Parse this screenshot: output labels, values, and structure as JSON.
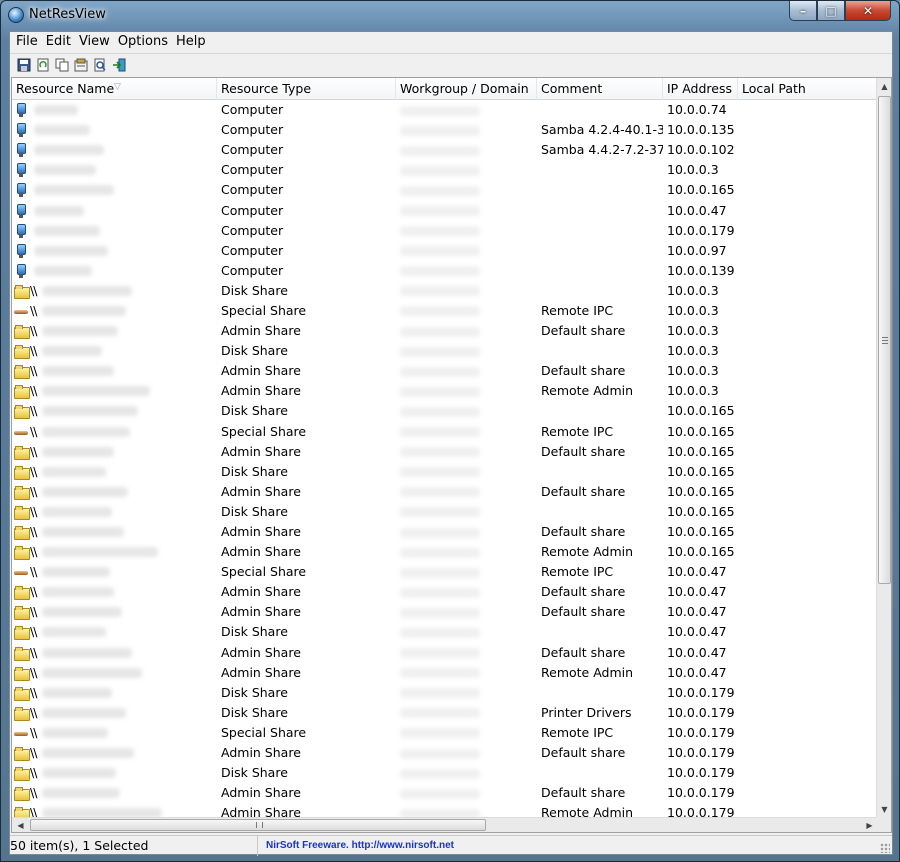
{
  "window": {
    "title": "NetResView"
  },
  "menu": [
    "File",
    "Edit",
    "View",
    "Options",
    "Help"
  ],
  "toolbar": [
    "save-icon",
    "refresh-icon",
    "copy-icon",
    "properties-icon",
    "find-icon",
    "exit-icon"
  ],
  "columns": [
    "Resource Name",
    "Resource Type",
    "Workgroup / Domain",
    "Comment",
    "IP Address",
    "Local Path"
  ],
  "rows": [
    {
      "icon": "computer",
      "prefix": "",
      "type": "Computer",
      "comment": "",
      "ip": "10.0.0.74"
    },
    {
      "icon": "computer",
      "prefix": "",
      "type": "Computer",
      "comment": "Samba 4.2.4-40.1-3...",
      "ip": "10.0.0.135"
    },
    {
      "icon": "computer",
      "prefix": "",
      "type": "Computer",
      "comment": "Samba 4.4.2-7.2-37...",
      "ip": "10.0.0.102"
    },
    {
      "icon": "computer",
      "prefix": "",
      "type": "Computer",
      "comment": "",
      "ip": "10.0.0.3"
    },
    {
      "icon": "computer",
      "prefix": "",
      "type": "Computer",
      "comment": "",
      "ip": "10.0.0.165"
    },
    {
      "icon": "computer",
      "prefix": "",
      "type": "Computer",
      "comment": "",
      "ip": "10.0.0.47"
    },
    {
      "icon": "computer",
      "prefix": "",
      "type": "Computer",
      "comment": "",
      "ip": "10.0.0.179"
    },
    {
      "icon": "computer",
      "prefix": "",
      "type": "Computer",
      "comment": "",
      "ip": "10.0.0.97"
    },
    {
      "icon": "computer",
      "prefix": "",
      "type": "Computer",
      "comment": "",
      "ip": "10.0.0.139"
    },
    {
      "icon": "folder",
      "prefix": "\\\\",
      "type": "Disk Share",
      "comment": "",
      "ip": "10.0.0.3"
    },
    {
      "icon": "pipe",
      "prefix": "\\\\",
      "type": "Special Share",
      "comment": "Remote IPC",
      "ip": "10.0.0.3"
    },
    {
      "icon": "folder",
      "prefix": "\\\\",
      "type": "Admin Share",
      "comment": "Default share",
      "ip": "10.0.0.3"
    },
    {
      "icon": "folder",
      "prefix": "\\\\",
      "type": "Disk Share",
      "comment": "",
      "ip": "10.0.0.3"
    },
    {
      "icon": "folder",
      "prefix": "\\\\",
      "type": "Admin Share",
      "comment": "Default share",
      "ip": "10.0.0.3"
    },
    {
      "icon": "folder",
      "prefix": "\\\\",
      "type": "Admin Share",
      "comment": "Remote Admin",
      "ip": "10.0.0.3"
    },
    {
      "icon": "folder",
      "prefix": "\\\\",
      "type": "Disk Share",
      "comment": "",
      "ip": "10.0.0.165"
    },
    {
      "icon": "pipe",
      "prefix": "\\\\",
      "type": "Special Share",
      "comment": "Remote IPC",
      "ip": "10.0.0.165"
    },
    {
      "icon": "folder",
      "prefix": "\\\\",
      "type": "Admin Share",
      "comment": "Default share",
      "ip": "10.0.0.165"
    },
    {
      "icon": "folder",
      "prefix": "\\\\",
      "type": "Disk Share",
      "comment": "",
      "ip": "10.0.0.165"
    },
    {
      "icon": "folder",
      "prefix": "\\\\",
      "type": "Admin Share",
      "comment": "Default share",
      "ip": "10.0.0.165"
    },
    {
      "icon": "folder",
      "prefix": "\\\\",
      "type": "Disk Share",
      "comment": "",
      "ip": "10.0.0.165"
    },
    {
      "icon": "folder",
      "prefix": "\\\\",
      "type": "Admin Share",
      "comment": "Default share",
      "ip": "10.0.0.165"
    },
    {
      "icon": "folder",
      "prefix": "\\\\",
      "type": "Admin Share",
      "comment": "Remote Admin",
      "ip": "10.0.0.165"
    },
    {
      "icon": "pipe",
      "prefix": "\\\\",
      "type": "Special Share",
      "comment": "Remote IPC",
      "ip": "10.0.0.47"
    },
    {
      "icon": "folder",
      "prefix": "\\\\",
      "type": "Admin Share",
      "comment": "Default share",
      "ip": "10.0.0.47"
    },
    {
      "icon": "folder",
      "prefix": "\\\\",
      "type": "Admin Share",
      "comment": "Default share",
      "ip": "10.0.0.47"
    },
    {
      "icon": "folder",
      "prefix": "\\\\",
      "type": "Disk Share",
      "comment": "",
      "ip": "10.0.0.47"
    },
    {
      "icon": "folder",
      "prefix": "\\\\",
      "type": "Admin Share",
      "comment": "Default share",
      "ip": "10.0.0.47"
    },
    {
      "icon": "folder",
      "prefix": "\\\\",
      "type": "Admin Share",
      "comment": "Remote Admin",
      "ip": "10.0.0.47"
    },
    {
      "icon": "folder",
      "prefix": "\\\\",
      "type": "Disk Share",
      "comment": "",
      "ip": "10.0.0.179"
    },
    {
      "icon": "folder",
      "prefix": "\\\\",
      "type": "Disk Share",
      "comment": "Printer Drivers",
      "ip": "10.0.0.179"
    },
    {
      "icon": "pipe",
      "prefix": "\\\\",
      "type": "Special Share",
      "comment": "Remote IPC",
      "ip": "10.0.0.179"
    },
    {
      "icon": "folder",
      "prefix": "\\\\",
      "type": "Admin Share",
      "comment": "Default share",
      "ip": "10.0.0.179"
    },
    {
      "icon": "folder",
      "prefix": "\\\\",
      "type": "Disk Share",
      "comment": "",
      "ip": "10.0.0.179"
    },
    {
      "icon": "folder",
      "prefix": "\\\\",
      "type": "Admin Share",
      "comment": "Default share",
      "ip": "10.0.0.179"
    },
    {
      "icon": "folder",
      "prefix": "\\\\",
      "type": "Admin Share",
      "comment": "Remote Admin",
      "ip": "10.0.0.179"
    }
  ],
  "status": {
    "count": "50 item(s), 1 Selected",
    "link": "NirSoft Freeware.  http://www.nirsoft.net"
  }
}
